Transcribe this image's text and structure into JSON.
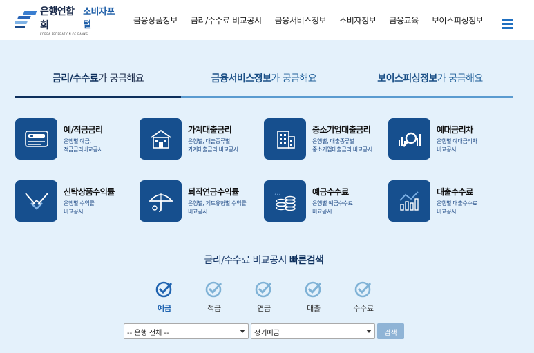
{
  "header": {
    "logo_kfb": "은행연합회",
    "logo_portal": "소비자포털",
    "logo_sub": "KOREA FEDERATION OF BANKS",
    "nav": [
      "금융상품정보",
      "금리/수수료 비교공시",
      "금융서비스정보",
      "소비자정보",
      "금융교육",
      "보이스피싱정보"
    ]
  },
  "tabs": [
    {
      "strong": "금리/수수료",
      "rest": "가 궁금해요"
    },
    {
      "strong": "금융서비스정보",
      "rest": "가 궁금해요"
    },
    {
      "strong": "보이스피싱정보",
      "rest": "가 궁금해요"
    }
  ],
  "cards": [
    {
      "title": "예/적금금리",
      "desc": "은행별 예금,\n적금금리비교공시",
      "icon": "savings-card-icon"
    },
    {
      "title": "가계대출금리",
      "desc": "은행별, 대출종류별\n가계대출금리 비교공시",
      "icon": "house-icon"
    },
    {
      "title": "중소기업대출금리",
      "desc": "은행별, 대출종류별\n중소기업대출금리 비교공시",
      "icon": "building-icon"
    },
    {
      "title": "예대금리차",
      "desc": "은행별 예대금리차\n비교공시",
      "icon": "magnifier-chart-icon"
    },
    {
      "title": "신탁상품수익률",
      "desc": "은행별 수익률\n비교공시",
      "icon": "handshake-icon"
    },
    {
      "title": "퇴직연금수익률",
      "desc": "은행별, 제도유형별 수익률\n비교공시",
      "icon": "umbrella-icon"
    },
    {
      "title": "예금수수료",
      "desc": "은행별 예금수수료\n비교공시",
      "icon": "coin-stack-icon"
    },
    {
      "title": "대출수수료",
      "desc": "은행별 대출수수료\n비교공시",
      "icon": "bar-chart-icon"
    }
  ],
  "quick_search": {
    "title_normal": "금리/수수료 비교공시 ",
    "title_strong": "빠른검색",
    "options": [
      "예금",
      "적금",
      "연금",
      "대출",
      "수수료"
    ],
    "selected": "예금",
    "bank_select": "-- 은행 전체 --",
    "type_select": "정기예금",
    "search_label": "검색"
  },
  "colors": {
    "accent": "#164f8e",
    "active": "#1f63b0",
    "inactive_check": "#7fb2d6",
    "background": "#e4f1fb"
  }
}
